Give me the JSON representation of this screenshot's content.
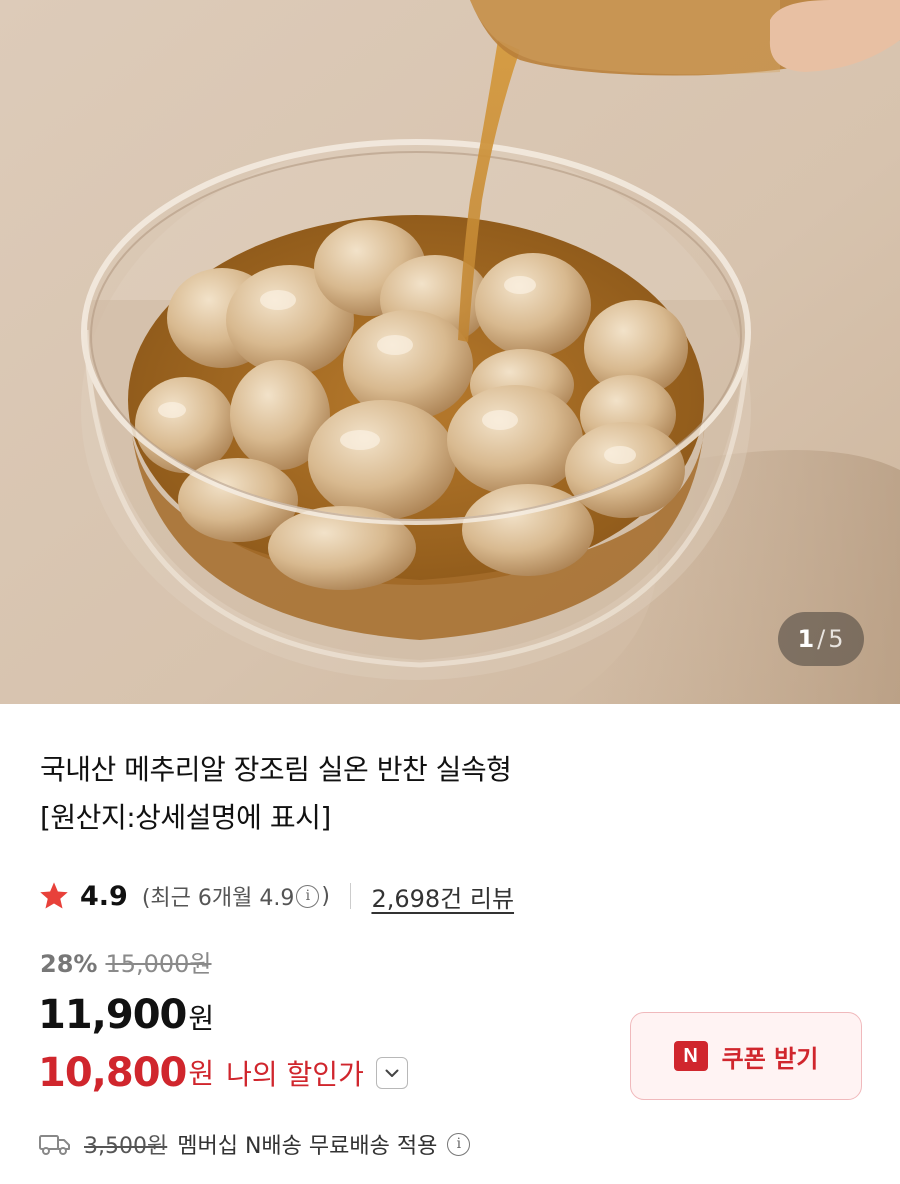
{
  "gallery": {
    "image_alt": "메추리알 장조림",
    "current": "1",
    "separator": "/",
    "total": "5"
  },
  "product": {
    "title_line1": "국내산 메추리알 장조림 실온 반찬 실속형",
    "title_line2": "[원산지:상세설명에 표시]"
  },
  "rating": {
    "icon": "star-icon",
    "score": "4.9",
    "recent_prefix": "(최근 6개월 4.9",
    "recent_suffix": ")",
    "review_link": "2,698건 리뷰"
  },
  "price": {
    "discount_rate": "28%",
    "original": "15,000원",
    "sale_number": "11,900",
    "sale_unit": "원",
    "my_price_number": "10,800",
    "my_price_unit": "원",
    "my_price_label": "나의 할인가"
  },
  "coupon": {
    "badge": "N",
    "label": "쿠폰 받기"
  },
  "shipping": {
    "icon": "truck-icon",
    "original_fee": "3,500원",
    "text": "멤버십 N배송 무료배송 적용"
  },
  "colors": {
    "accent_red": "#d0262d",
    "star": "#e8413a",
    "coupon_bg": "#fff3f3"
  }
}
